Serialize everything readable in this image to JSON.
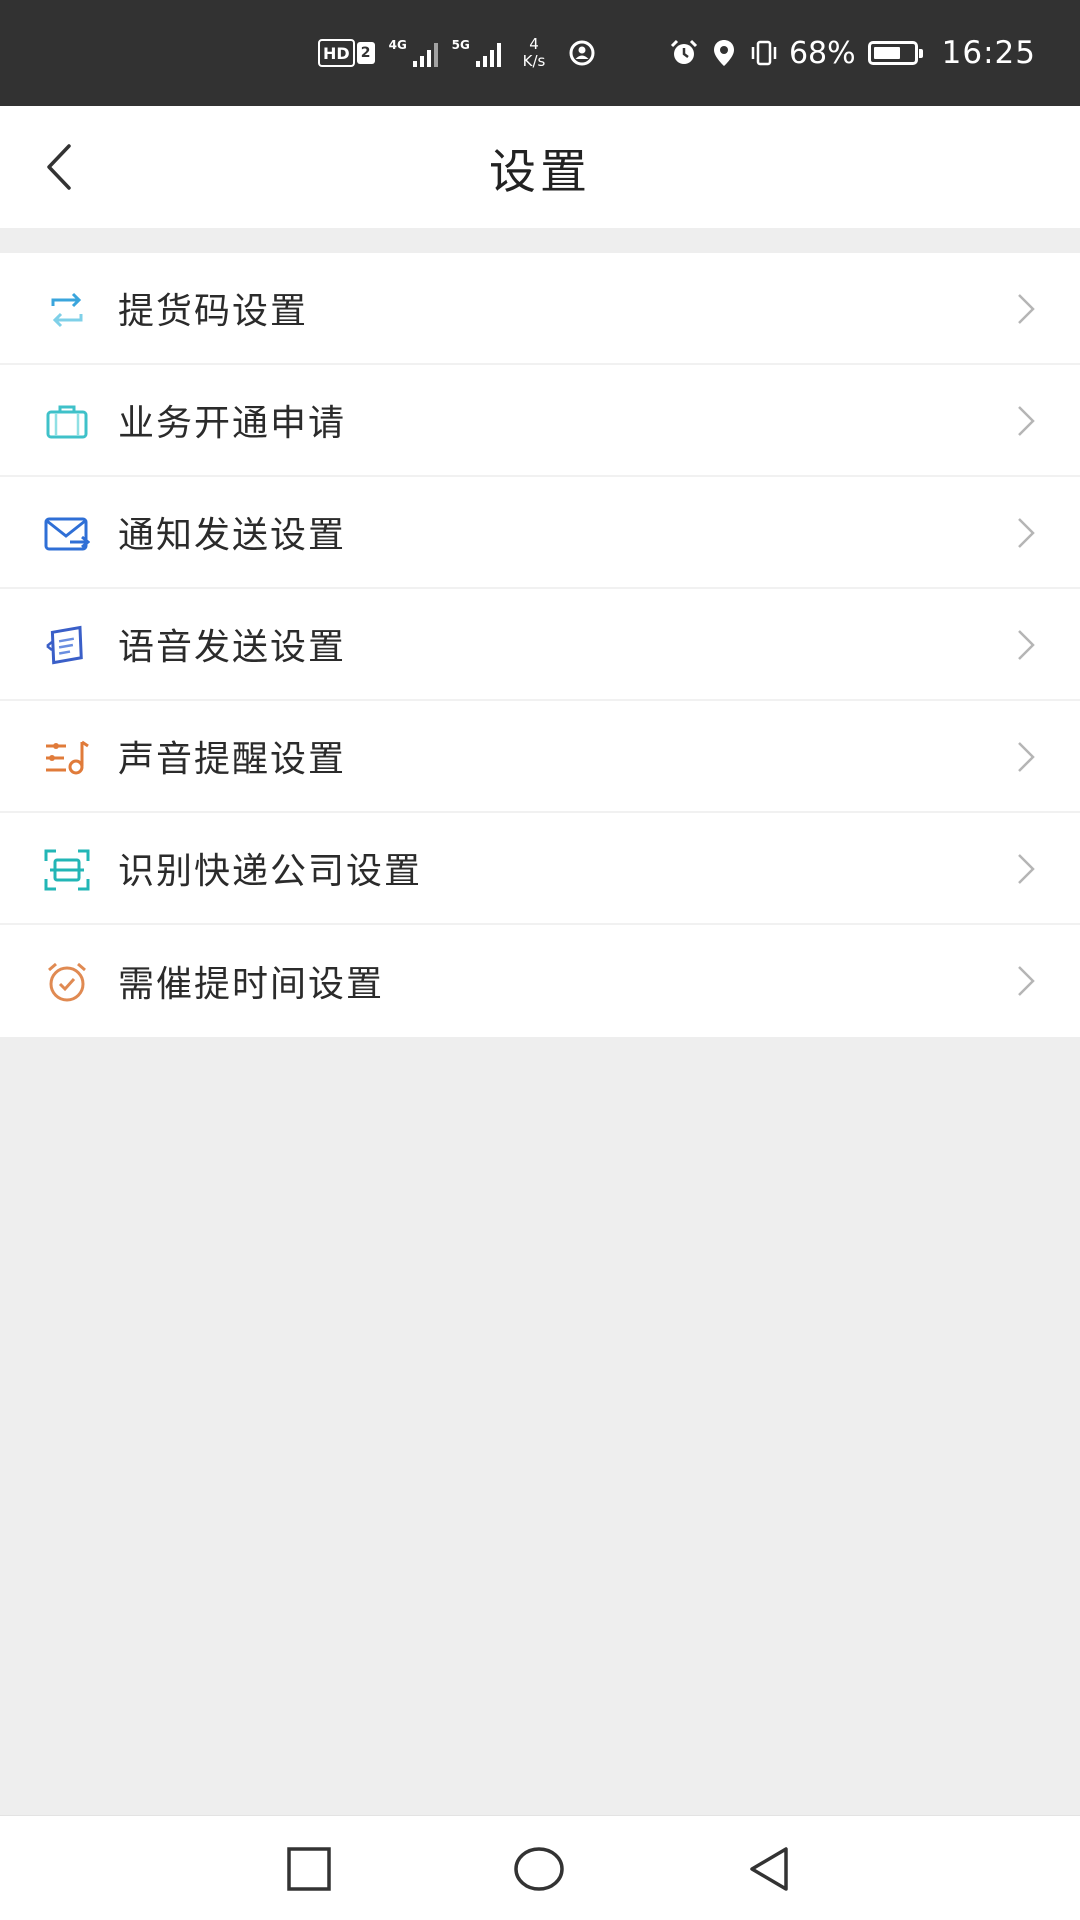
{
  "status_bar": {
    "hd_label": "HD",
    "sim_label": "2",
    "network_1": "4G",
    "network_2": "5G",
    "speed_value": "4",
    "speed_unit": "K/s",
    "battery_percent": "68%",
    "battery_level": 0.68,
    "time": "16:25"
  },
  "header": {
    "title": "设置"
  },
  "menu": {
    "items": [
      {
        "label": "提货码设置",
        "icon": "refresh-arrows-icon",
        "color": "#3aa5dc"
      },
      {
        "label": "业务开通申请",
        "icon": "briefcase-icon",
        "color": "#3fc1c9"
      },
      {
        "label": "通知发送设置",
        "icon": "mail-send-icon",
        "color": "#2f6fd6"
      },
      {
        "label": "语音发送设置",
        "icon": "voice-message-icon",
        "color": "#3a5fc8"
      },
      {
        "label": "声音提醒设置",
        "icon": "sound-settings-icon",
        "color": "#e07b3a"
      },
      {
        "label": "识别快递公司设置",
        "icon": "scan-icon",
        "color": "#22b6b6"
      },
      {
        "label": "需催提时间设置",
        "icon": "alarm-clock-icon",
        "color": "#e08a52"
      }
    ]
  },
  "colors": {
    "status_bar_bg": "#323232",
    "page_bg": "#eeeeee",
    "chevron": "#b5b5b5"
  }
}
